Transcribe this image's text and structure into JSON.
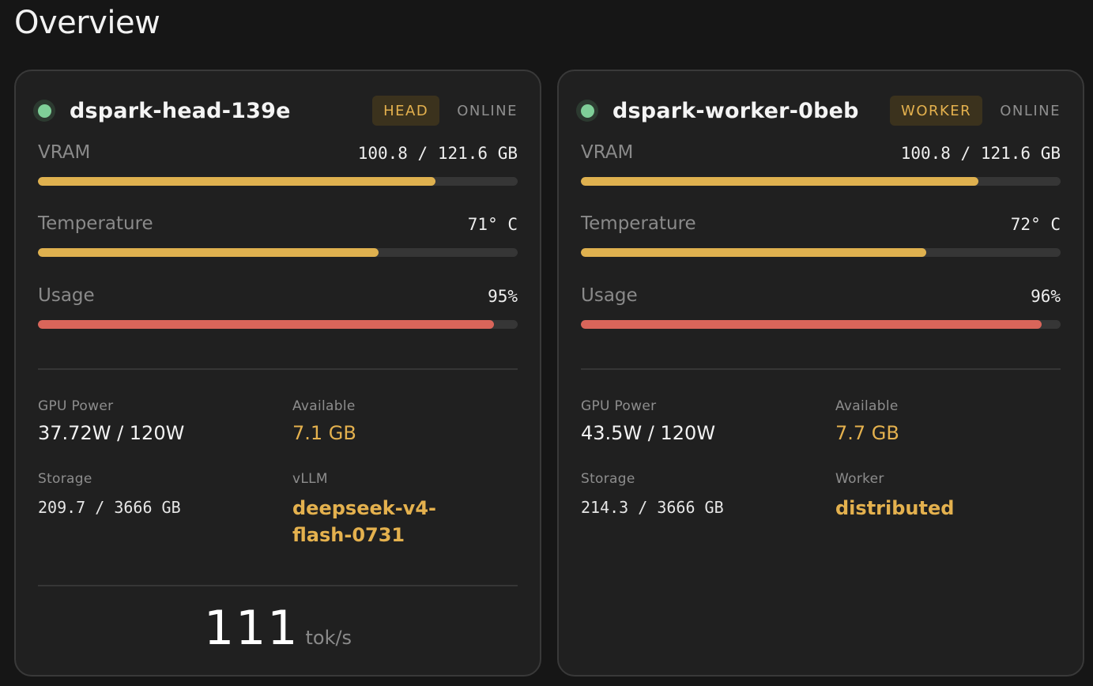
{
  "page": {
    "title": "Overview"
  },
  "nodes": [
    {
      "name": "dspark-head-139e",
      "role": "HEAD",
      "status": "ONLINE",
      "metrics": {
        "vram": {
          "label": "VRAM",
          "value": "100.8 / 121.6 GB",
          "fill": 0.829
        },
        "temperature": {
          "label": "Temperature",
          "value": "71° C",
          "fill": 0.71
        },
        "usage": {
          "label": "Usage",
          "value": "95%",
          "fill": 0.95
        }
      },
      "stats": {
        "gpu_power": {
          "label": "GPU Power",
          "value": "37.72W / 120W"
        },
        "available": {
          "label": "Available",
          "value": "7.1 GB"
        },
        "storage": {
          "label": "Storage",
          "value": "209.7 / 3666 GB"
        },
        "extra": {
          "label": "vLLM",
          "value": "deepseek-v4-flash-0731"
        }
      },
      "throughput": {
        "value": "111",
        "unit": "tok/s"
      }
    },
    {
      "name": "dspark-worker-0beb",
      "role": "WORKER",
      "status": "ONLINE",
      "metrics": {
        "vram": {
          "label": "VRAM",
          "value": "100.8 / 121.6 GB",
          "fill": 0.829
        },
        "temperature": {
          "label": "Temperature",
          "value": "72° C",
          "fill": 0.72
        },
        "usage": {
          "label": "Usage",
          "value": "96%",
          "fill": 0.96
        }
      },
      "stats": {
        "gpu_power": {
          "label": "GPU Power",
          "value": "43.5W / 120W"
        },
        "available": {
          "label": "Available",
          "value": "7.7 GB"
        },
        "storage": {
          "label": "Storage",
          "value": "214.3 / 3666 GB"
        },
        "extra": {
          "label": "Worker",
          "value": "distributed"
        }
      }
    }
  ],
  "colors": {
    "accent": "#e4b14e",
    "bar_yellow": "#dfb14f",
    "bar_red": "#d9655a",
    "online_dot": "#7fcf98"
  }
}
